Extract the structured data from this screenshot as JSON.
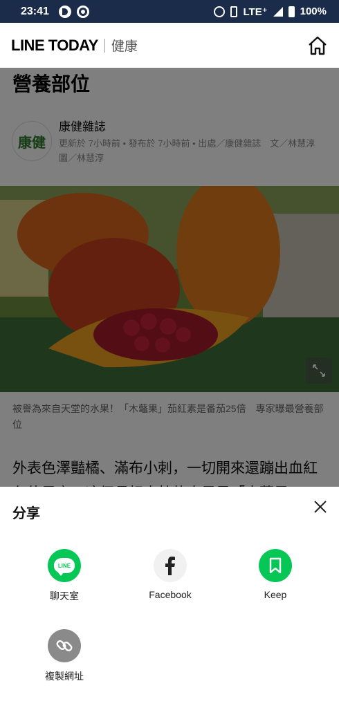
{
  "status_bar": {
    "time": "23:41",
    "network": "LTE⁺",
    "battery": "100%"
  },
  "header": {
    "logo": "LINE TODAY",
    "section": "健康"
  },
  "article": {
    "title": "營養部位",
    "publisher": "康健雜誌",
    "publisher_logo": "康健",
    "meta": "更新於 7小時前 • 發布於 7小時前 • 出處／康健雜誌　文／林慧淳　圖／林慧淳",
    "caption": "被譽為來自天堂的水果！「木虌果」茄紅素是番茄25倍　專家曝最營養部位",
    "lead": "外表色澤豔橘、滿布小刺，一切開來還蹦出血紅色的果實，這個長相奇特的水果是「木虌果"
  },
  "share": {
    "title": "分享",
    "items": [
      {
        "label": "聊天室",
        "icon": "line-icon",
        "color": "#06c755"
      },
      {
        "label": "Facebook",
        "icon": "facebook-icon",
        "color": "#f1f1f1"
      },
      {
        "label": "Keep",
        "icon": "keep-bookmark-icon",
        "color": "#06c755"
      },
      {
        "label": "複製網址",
        "icon": "link-icon",
        "color": "#8a8a8a"
      }
    ]
  }
}
